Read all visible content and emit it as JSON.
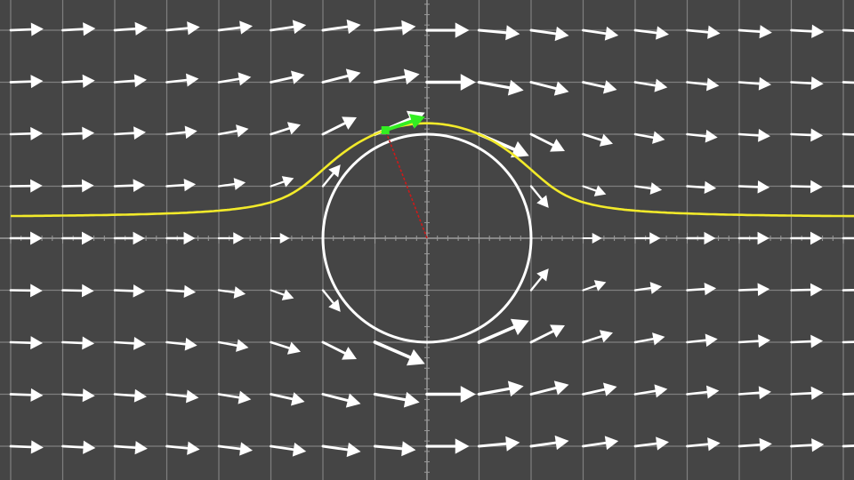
{
  "scene": {
    "background": "#454545",
    "grid_color": "#8a8a8a",
    "axis_color": "#9a9a9a",
    "arrow_color": "#ffffff",
    "circle_color": "#ffffff",
    "streamline_color": "#f2ea2a",
    "velocity_color": "#33ee22",
    "radius_color": "#cc1a1a",
    "particle_color": "#33ee22"
  },
  "field": {
    "type": "potential-flow-past-cylinder",
    "free_stream_direction": "left-to-right",
    "cylinder_radius": 1,
    "grid_spacing": 0.5,
    "x_range": [
      -4,
      4
    ],
    "y_range": [
      -2.25,
      2.25
    ]
  },
  "probe": {
    "x": -0.4,
    "y": 1.2,
    "streamline_start_y": 0.2
  }
}
